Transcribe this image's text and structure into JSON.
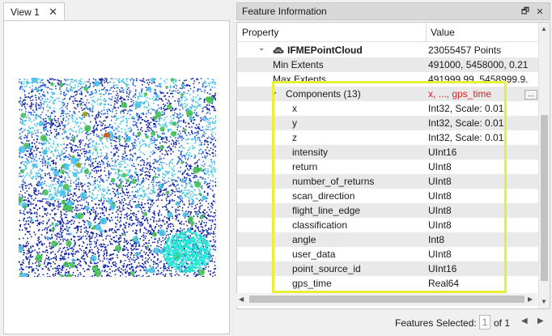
{
  "view": {
    "tab_label": "View 1",
    "close_glyph": "✕",
    "colors": {
      "deep": "#0a1ea8",
      "mid": "#1e63d8",
      "light": "#40c0e8",
      "cyan": "#22e6d6",
      "green": "#3cc04c",
      "olive": "#a0a020",
      "orange": "#c8641e"
    }
  },
  "panel": {
    "title": "Feature Information",
    "float_icon": "🗗",
    "close_icon": "✕"
  },
  "columns": {
    "property": "Property",
    "value": "Value"
  },
  "rows": [
    {
      "prop": "IFMEPointCloud",
      "value": "23055457 Points",
      "indent": 1,
      "expander": "⌄",
      "icon": "cloud-icon",
      "bold": true
    },
    {
      "prop": "Min Extents",
      "value": "491000, 5458000, 0.21",
      "indent": 2
    },
    {
      "prop": "Max Extents",
      "value": "491999.99, 5458999.9...",
      "indent": 2
    },
    {
      "prop": "Components (13)",
      "value": "x, ..., gps_time",
      "indent": 2,
      "expander": "⌄",
      "value_color": "#e02020"
    },
    {
      "prop": "x",
      "value": "Int32, Scale: 0.01",
      "indent": 3
    },
    {
      "prop": "y",
      "value": "Int32, Scale: 0.01",
      "indent": 3
    },
    {
      "prop": "z",
      "value": "Int32, Scale: 0.01",
      "indent": 3
    },
    {
      "prop": "intensity",
      "value": "UInt16",
      "indent": 3
    },
    {
      "prop": "return",
      "value": "UInt8",
      "indent": 3
    },
    {
      "prop": "number_of_returns",
      "value": "UInt8",
      "indent": 3
    },
    {
      "prop": "scan_direction",
      "value": "UInt8",
      "indent": 3
    },
    {
      "prop": "flight_line_edge",
      "value": "UInt8",
      "indent": 3
    },
    {
      "prop": "classification",
      "value": "UInt8",
      "indent": 3
    },
    {
      "prop": "angle",
      "value": "Int8",
      "indent": 3
    },
    {
      "prop": "user_data",
      "value": "UInt8",
      "indent": 3
    },
    {
      "prop": "point_source_id",
      "value": "UInt16",
      "indent": 3
    },
    {
      "prop": "gps_time",
      "value": "Real64",
      "indent": 3
    }
  ],
  "more_button": "...",
  "footer": {
    "selected_label": "Features Selected:",
    "selected_value": "1",
    "of_label": "of 1",
    "prev_icon": "◀",
    "next_icon": "▶"
  },
  "highlight_color": "#e7f039"
}
